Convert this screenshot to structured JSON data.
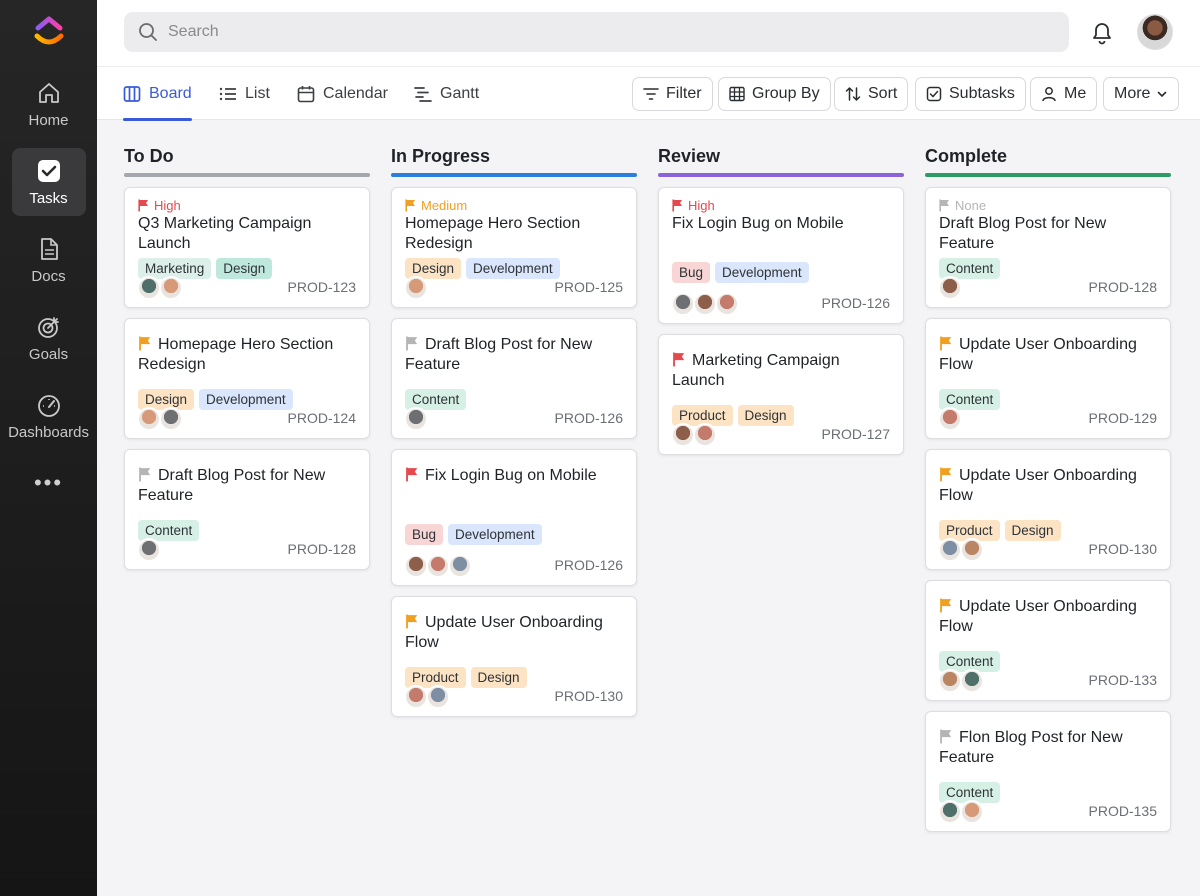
{
  "sidebar": {
    "items": [
      {
        "label": "Home",
        "icon": "home-icon"
      },
      {
        "label": "Tasks",
        "icon": "check-icon",
        "active": true
      },
      {
        "label": "Docs",
        "icon": "doc-icon"
      },
      {
        "label": "Goals",
        "icon": "target-icon"
      },
      {
        "label": "Dashboards",
        "icon": "gauge-icon"
      }
    ],
    "more": "•••"
  },
  "search": {
    "placeholder": "Search"
  },
  "views": [
    {
      "label": "Board",
      "icon": "board-icon",
      "active": true
    },
    {
      "label": "List",
      "icon": "list-icon"
    },
    {
      "label": "Calendar",
      "icon": "calendar-icon"
    },
    {
      "label": "Gantt",
      "icon": "gantt-icon"
    }
  ],
  "toolbar": {
    "filter": "Filter",
    "group_by": "Group By",
    "sort": "Sort",
    "subtasks": "Subtasks",
    "me": "Me",
    "more": "More"
  },
  "colors": {
    "high": "#e5484d",
    "medium": "#f0a020",
    "none": "#b5b5b8",
    "todo_bar": "#a4a7ad",
    "inprogress_bar": "#2b7fdc",
    "review_bar": "#8a63d9",
    "complete_bar": "#2e9a66",
    "tag_marketing": "#dcefe9",
    "tag_design_teal": "#bfe8dd",
    "tag_design_orange": "#fbe3c4",
    "tag_development": "#d9e6fb",
    "tag_content": "#d6f0e6",
    "tag_bug": "#f9d6d6",
    "tag_product": "#fbe3c4"
  },
  "columns": [
    {
      "title": "To Do",
      "cards": [
        {
          "priority_label": "High",
          "priority": "high",
          "title": "Q3 Marketing Campaign Launch",
          "tags": [
            "Marketing",
            "Design"
          ],
          "id": "PROD-123"
        },
        {
          "priority": "medium",
          "title": "Homepage Hero Section Redesign",
          "tags": [
            "Design",
            "Development"
          ],
          "id": "PROD-124"
        },
        {
          "priority": "none",
          "title": "Draft Blog Post for New Feature",
          "tags": [
            "Content"
          ],
          "id": "PROD-128"
        }
      ]
    },
    {
      "title": "In Progress",
      "cards": [
        {
          "priority_label": "Medium",
          "priority": "medium",
          "title": "Homepage Hero Section Redesign",
          "tags": [
            "Design",
            "Development"
          ],
          "id": "PROD-125"
        },
        {
          "priority": "none",
          "title": "Draft Blog Post for New Feature",
          "tags": [
            "Content"
          ],
          "id": "PROD-126"
        },
        {
          "priority": "high",
          "title": "Fix Login Bug on Mobile",
          "tags": [
            "Bug",
            "Development"
          ],
          "id": "PROD-126"
        },
        {
          "priority": "medium",
          "title": "Update User Onboarding Flow",
          "tags": [
            "Product",
            "Design"
          ],
          "id": "PROD-130"
        }
      ]
    },
    {
      "title": "Review",
      "cards": [
        {
          "priority_label": "High",
          "priority": "high",
          "title": "Fix Login Bug on Mobile",
          "tags": [
            "Bug",
            "Development"
          ],
          "id": "PROD-126"
        },
        {
          "priority": "high",
          "title": "Marketing Campaign Launch",
          "tags": [
            "Product",
            "Design"
          ],
          "id": "PROD-127"
        }
      ]
    },
    {
      "title": "Complete",
      "cards": [
        {
          "priority_label": "None",
          "priority": "none",
          "title": "Draft Blog Post for New Feature",
          "tags": [
            "Content"
          ],
          "id": "PROD-128"
        },
        {
          "priority": "medium",
          "title": "Update User Onboarding Flow",
          "tags": [
            "Content"
          ],
          "id": "PROD-129"
        },
        {
          "priority": "medium",
          "title": "Update User Onboarding Flow",
          "tags": [
            "Product",
            "Design"
          ],
          "id": "PROD-130"
        },
        {
          "priority": "medium",
          "title": "Update User Onboarding Flow",
          "tags": [
            "Content"
          ],
          "id": "PROD-133"
        },
        {
          "priority": "none",
          "title": "Flon Blog Post for New Feature",
          "tags": [
            "Content"
          ],
          "id": "PROD-135"
        }
      ]
    }
  ]
}
